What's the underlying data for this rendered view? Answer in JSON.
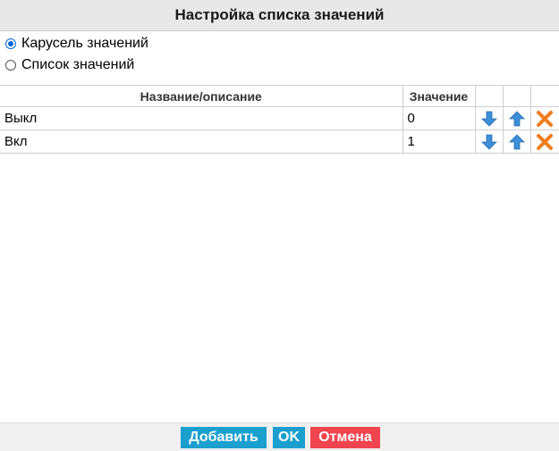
{
  "dialog": {
    "title": "Настройка списка значений"
  },
  "mode": {
    "options": [
      {
        "label": "Карусель значений",
        "checked": true
      },
      {
        "label": "Список значений",
        "checked": false
      }
    ]
  },
  "table": {
    "headers": {
      "name": "Название/описание",
      "value": "Значение"
    },
    "rows": [
      {
        "name": "Выкл",
        "value": "0"
      },
      {
        "name": "Вкл",
        "value": "1"
      }
    ],
    "icons": {
      "move_down": "arrow-down-icon",
      "move_up": "arrow-up-icon",
      "delete": "close-icon"
    }
  },
  "footer": {
    "add_label": "Добавить",
    "ok_label": "OK",
    "cancel_label": "Отмена"
  },
  "colors": {
    "primary_button": "#1a9fcf",
    "cancel_button": "#f0444f",
    "arrow_icon": "#3d8fd8",
    "delete_icon": "#f07c1c"
  }
}
